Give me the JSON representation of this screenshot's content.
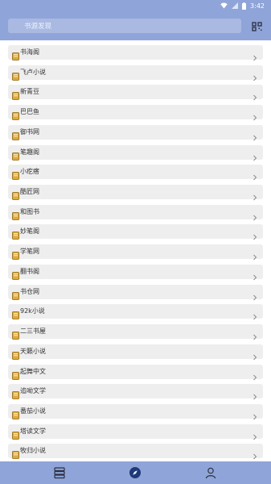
{
  "status": {
    "time": "3:42",
    "icons": [
      "wifi-icon",
      "signal-icon",
      "battery-icon"
    ]
  },
  "search": {
    "placeholder": "书源发现"
  },
  "sources": [
    "书海阁",
    "飞卢小说",
    "新青豆",
    "巴巴鱼",
    "御书网",
    "笔趣阁",
    "小疙瘩",
    "酷匠网",
    "和图书",
    "妙笔阁",
    "学笔网",
    "翻书阁",
    "书仓网",
    "92k小说",
    "二三书屋",
    "天籁小说",
    "起舞中文",
    "追呦文学",
    "番茄小说",
    "塔读文学",
    "牧归小说"
  ],
  "bottom_tabs": [
    {
      "icon": "bookshelf-icon"
    },
    {
      "icon": "discover-compass-icon",
      "active": true
    },
    {
      "icon": "profile-icon"
    }
  ],
  "colors": {
    "primary": "#8fa4d8",
    "row_bg": "#eeeeee"
  }
}
